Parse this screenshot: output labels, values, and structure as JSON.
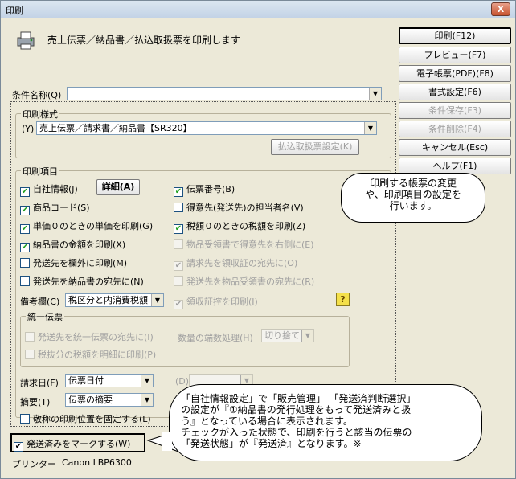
{
  "window": {
    "title": "印刷",
    "close": "X"
  },
  "header": {
    "message": "売上伝票／納品書／払込取扱票を印刷します"
  },
  "buttons": {
    "print": "印刷(F12)",
    "preview": "プレビュー(F7)",
    "pdf": "電子帳票(PDF)(F8)",
    "settings": "書式設定(F6)",
    "save_cond": "条件保存(F3)",
    "delete_cond": "条件削除(F4)",
    "cancel": "キャンセル(Esc)",
    "help": "ヘルプ(F1)"
  },
  "condition": {
    "label": "条件名称(Q)",
    "value": ""
  },
  "print_style": {
    "legend": "印刷様式",
    "prefix": "(Y)",
    "value": "売上伝票／請求書／納品書【SR320】",
    "payment_btn": "払込取扱票設定(K)"
  },
  "print_items": {
    "legend": "印刷項目",
    "company_info": "自社情報(J)",
    "detail_btn": "詳細(A)",
    "voucher_no": "伝票番号(B)",
    "product_code": "商品コード(S)",
    "customer_person": "得意先(発送先)の担当者名(V)",
    "unit_price_zero": "単価０のときの単価を印刷(G)",
    "tax_zero": "税額０のときの税額を印刷(Z)",
    "delivery_amount": "納品書の金額を印刷(X)",
    "receipt_right": "物品受領書で得意先を右側に(E)",
    "overseas": "発送先を欄外に印刷(M)",
    "receipt_addressee": "請求先を領収証の宛先に(O)",
    "delivery_addressee": "発送先を納品書の宛先に(N)",
    "goods_addressee": "発送先を物品受領書の宛先に(R)",
    "remarks_label": "備考欄(C)",
    "remarks_value": "税区分と内消費税額",
    "receipt_stamp": "領収証控を印刷(I)"
  },
  "unified": {
    "legend": "統一伝票",
    "addressee": "発送先を統一伝票の宛先に(I)",
    "rounding_label": "数量の端数処理(H)",
    "rounding_value": "切り捨て",
    "tax_excluded": "税抜分の税額を明細に印刷(P)"
  },
  "billing_date": {
    "label": "請求日(F)",
    "value": "伝票日付",
    "d_label": "(D)"
  },
  "summary": {
    "label": "摘要(T)",
    "value": "伝票の摘要"
  },
  "honorific": "敬称の印刷位置を固定する(L)",
  "mark_shipped": "発送済みをマークする(W)",
  "printer": {
    "label": "プリンター",
    "value": "Canon LBP6300"
  },
  "callouts": {
    "c1_line1": "印刷する帳票の変更",
    "c1_line2": "や、印刷項目の設定を",
    "c1_line3": "行います。",
    "c2_line1": "「自社情報設定」で「販売管理」-「発送済判断選択」",
    "c2_line2": "の設定が『①納品書の発行処理をもって発送済みと扱",
    "c2_line3": "う』となっている場合に表示されます。",
    "c2_line4": "チェックが入った状態で、印刷を行うと該当の伝票の",
    "c2_line5": "「発送状態」が『発送済』となります。※"
  },
  "icons": {
    "check": "✔",
    "arrow": "▼",
    "hint": "?"
  }
}
